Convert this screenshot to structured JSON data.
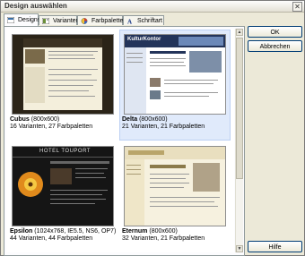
{
  "window": {
    "title": "Design auswählen",
    "close_glyph": "✕"
  },
  "tabs": [
    {
      "label": "Designs",
      "icon": "designs-icon"
    },
    {
      "label": "Varianten",
      "icon": "variants-icon"
    },
    {
      "label": "Farbpaletten",
      "icon": "palette-icon"
    },
    {
      "label": "Schriftart",
      "icon": "font-icon"
    }
  ],
  "designs": [
    {
      "name": "Cubus",
      "resolution": "(800x600)",
      "meta": "16 Varianten, 27 Farbpaletten",
      "selected": false
    },
    {
      "name": "Delta",
      "resolution": "(800x600)",
      "meta": "21 Varianten, 21 Farbpaletten",
      "selected": true,
      "thumb_header": "KulturKontor"
    },
    {
      "name": "Epsilon",
      "resolution": "(1024x768, IE5.5, NS6, OP7)",
      "meta": "44 Varianten, 44 Farbpaletten",
      "selected": false,
      "thumb_header": "HOTEL TOUPORT"
    },
    {
      "name": "Eternum",
      "resolution": "(800x600)",
      "meta": "32 Varianten, 21 Farbpaletten",
      "selected": false
    }
  ],
  "buttons": {
    "ok": {
      "label": "OK"
    },
    "cancel": {
      "label": "Abbrechen"
    },
    "help": {
      "label": "Hilfe"
    }
  },
  "colors": {
    "selection": "#e0eafb",
    "button_border": "#003c74",
    "tab_border": "#919b9c"
  }
}
